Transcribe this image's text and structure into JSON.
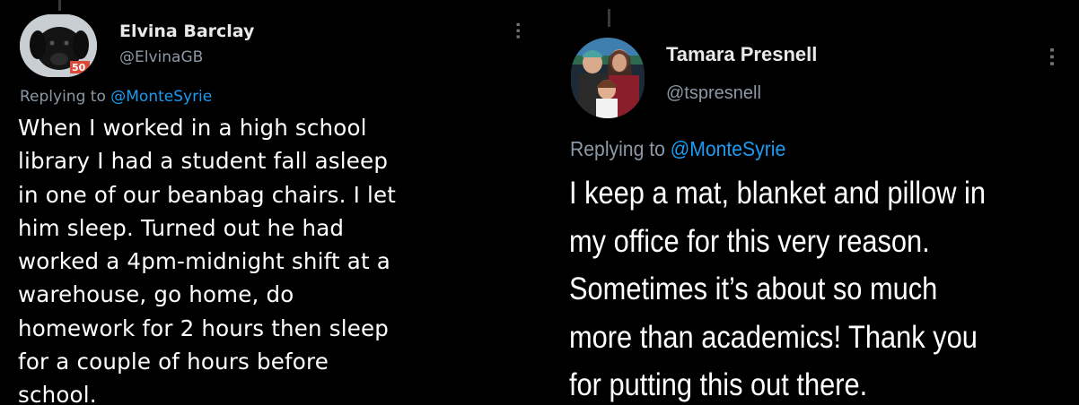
{
  "tweets": [
    {
      "author_name": "Elvina Barclay",
      "handle": "@ElvinaGB",
      "replying_prefix": "Replying to ",
      "replying_to": "@MonteSyrie",
      "avatar_badge": "50",
      "body_lines": [
        "When I worked in a high school",
        "library I had a student fall asleep",
        "in one of our beanbag chairs. I let",
        "him sleep. Turned out he had",
        "worked a 4pm-midnight shift at a",
        "warehouse, go home, do",
        "homework for 2 hours then sleep",
        "for a couple of hours before",
        "school."
      ]
    },
    {
      "author_name": "Tamara Presnell",
      "handle": "@tspresnell",
      "replying_prefix": "Replying to ",
      "replying_to": "@MonteSyrie",
      "body_lines": [
        "I keep a mat, blanket and pillow in",
        "my office for this very reason.",
        "Sometimes it’s about so much",
        "more than academics! Thank you",
        "for putting this out there."
      ]
    }
  ],
  "icons": {
    "more": "more-options-icon"
  }
}
